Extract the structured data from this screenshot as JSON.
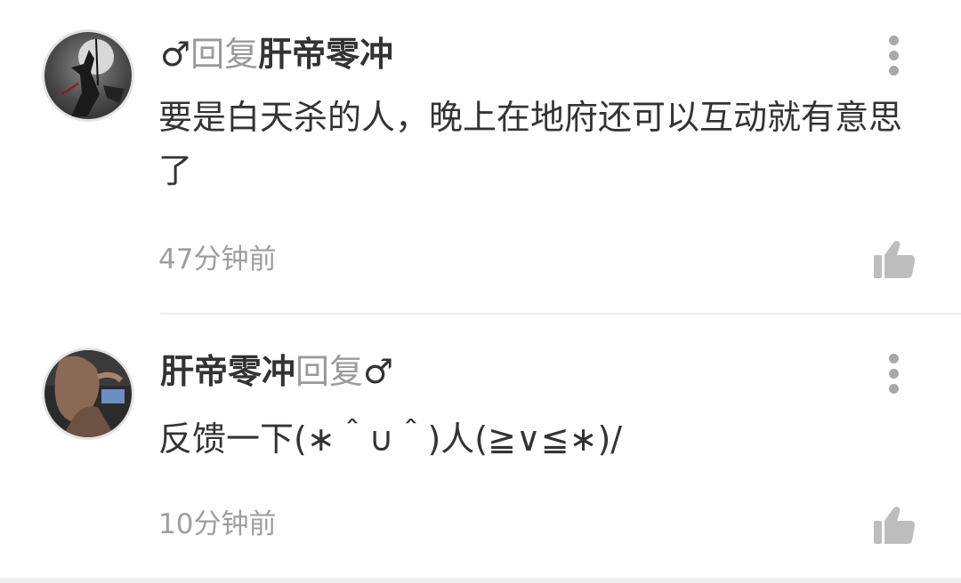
{
  "comments": [
    {
      "from_user": "♂",
      "reply_word": "回复",
      "to_user": "肝帝零冲",
      "text": "要是白天杀的人，晚上在地府还可以互动就有意思了",
      "time": "47分钟前"
    },
    {
      "from_user": "肝帝零冲",
      "reply_word": "回复",
      "to_user": "♂",
      "text": "反馈一下(∗＾∪＾)人(≧∨≦∗)/",
      "time": "10分钟前"
    }
  ],
  "icons": {
    "more": "more-vertical-icon",
    "like": "thumbs-up-icon"
  },
  "colors": {
    "username": "#333333",
    "reply_word": "#9a9a9a",
    "time": "#9e9e9e",
    "icon": "#bdbdbd"
  }
}
